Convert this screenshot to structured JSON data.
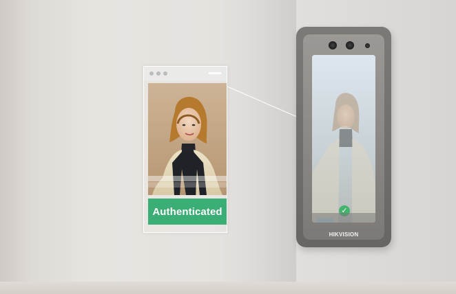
{
  "overlay": {
    "status_label": "Authenticated",
    "status_color": "#3bae76"
  },
  "device": {
    "brand_label": "HIKVISION",
    "check_icon": "check-icon"
  },
  "icons": {
    "overlay_menu_icon": "menu-icon",
    "device_check_icon": "check-icon"
  }
}
